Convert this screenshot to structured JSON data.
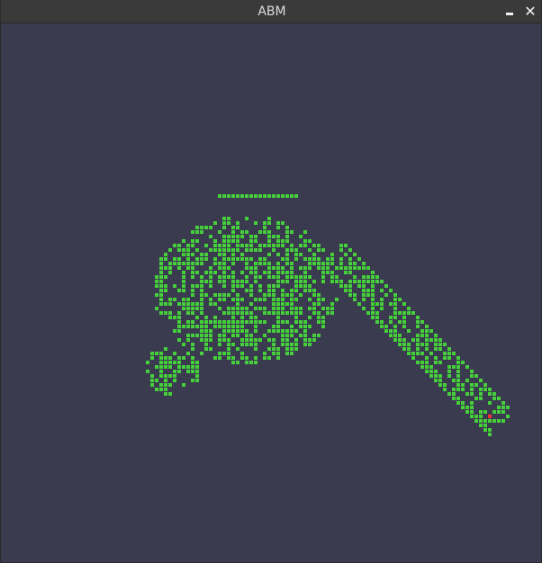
{
  "window": {
    "title": "ABM"
  },
  "controls": {
    "minimize_icon": "minimize-icon",
    "close_icon": "close-icon",
    "close_glyph": "✕"
  },
  "colors": {
    "background": "#3b3b50",
    "titlebar": "#3a3a3a",
    "agent": "#45d03b",
    "agent_highlight": "#ff3030"
  }
}
